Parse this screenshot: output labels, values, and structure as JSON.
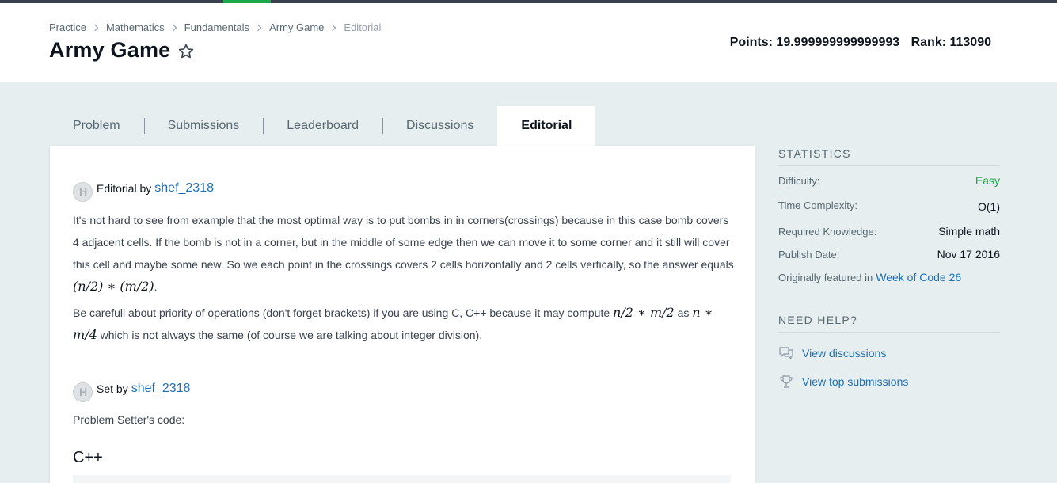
{
  "breadcrumb": [
    "Practice",
    "Mathematics",
    "Fundamentals",
    "Army Game",
    "Editorial"
  ],
  "title": "Army Game",
  "points_label": "Points: 19.999999999999993",
  "rank_label": "Rank: 113090",
  "tabs": [
    "Problem",
    "Submissions",
    "Leaderboard",
    "Discussions",
    "Editorial"
  ],
  "active_tab": "Editorial",
  "editorial": {
    "by_label": "Editorial by",
    "author": "shef_2318",
    "p1_text": "It's not hard to see from example that the most optimal way is to put bombs in in corners(crossings) because in this case bomb covers 4 adjacent cells. If the bomb is not in a corner, but in the middle of some edge then we can move it to some corner and it still will cover this cell and maybe some new. So we each point in the crossings covers 2 cells horizontally and 2 cells vertically, so the answer equals",
    "p1_math": "(n/2) ∗ (m/2)",
    "p1_end": ".",
    "p2_text": "Be carefull about priority of operations (don't forget brackets) if you are using C, C++ because it may compute",
    "p2_math1": "n/2 ∗ m/2",
    "p2_as": "as",
    "p2_math2": "n ∗ m/4",
    "p2_end": "which is not always the same (of course we are talking about integer division)."
  },
  "setter": {
    "by_label": "Set by",
    "author": "shef_2318",
    "code_label": "Problem Setter's code:",
    "language": "C++"
  },
  "statistics": {
    "title": "STATISTICS",
    "difficulty_label": "Difficulty:",
    "difficulty": "Easy",
    "time_label": "Time Complexity:",
    "time": "O(1)",
    "knowledge_label": "Required Knowledge:",
    "knowledge": "Simple math",
    "publish_label": "Publish Date:",
    "publish": "Nov 17 2016",
    "featured_label": "Originally featured in",
    "featured_link": "Week of Code 26"
  },
  "help": {
    "title": "NEED HELP?",
    "discussions": "View discussions",
    "top_submissions": "View top submissions"
  },
  "colors": {
    "accent": "#1ba94c",
    "link": "#1f6fb2",
    "easy": "#1ba94c"
  },
  "icons": {
    "star": "star-outline-icon",
    "discussion": "chat-bubble-icon",
    "trophy": "trophy-icon"
  }
}
